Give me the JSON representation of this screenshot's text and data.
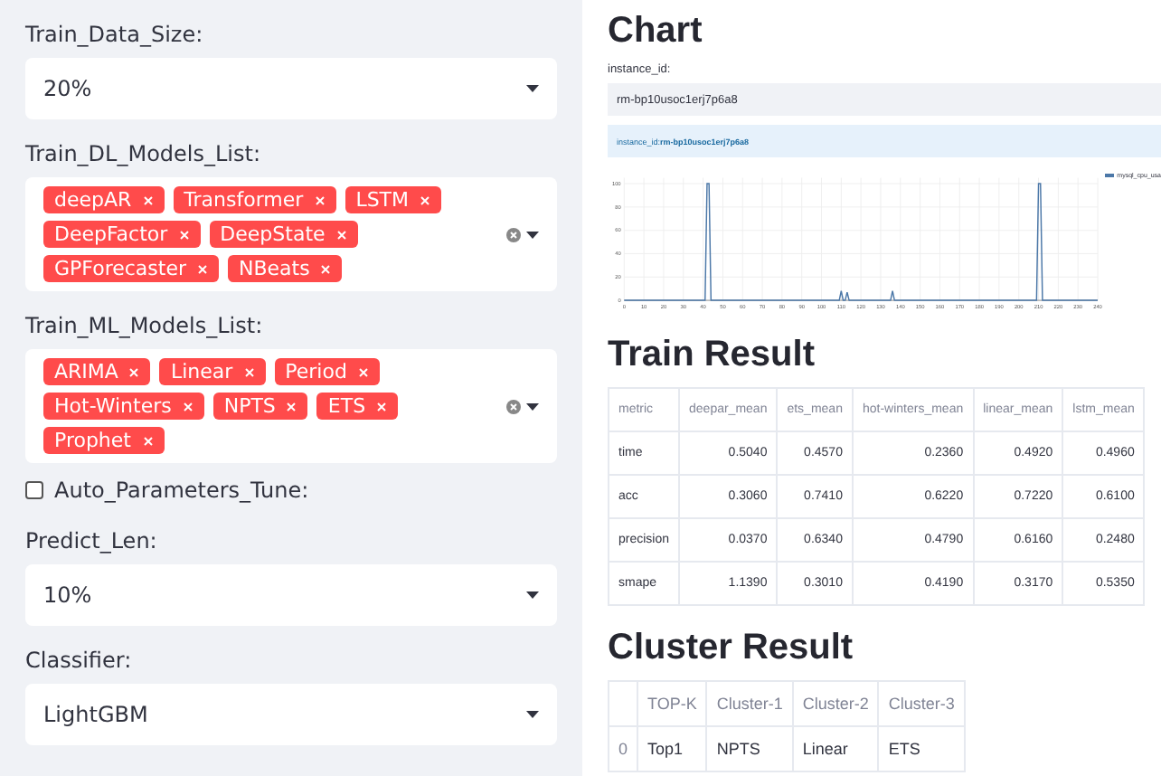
{
  "sidebar": {
    "controls": [
      {
        "kind": "select",
        "label": "Train_Data_Size:",
        "value": "20%"
      },
      {
        "kind": "multiselect",
        "label": "Train_DL_Models_List:",
        "tags": [
          "deepAR",
          "Transformer",
          "LSTM",
          "DeepFactor",
          "DeepState",
          "GPForecaster",
          "NBeats"
        ]
      },
      {
        "kind": "multiselect",
        "label": "Train_ML_Models_List:",
        "tags": [
          "ARIMA",
          "Linear",
          "Period",
          "Hot-Winters",
          "NPTS",
          "ETS",
          "Prophet"
        ]
      },
      {
        "kind": "checkbox",
        "label": "Auto_Parameters_Tune:",
        "checked": false
      },
      {
        "kind": "select",
        "label": "Predict_Len:",
        "value": "10%"
      },
      {
        "kind": "select",
        "label": "Classifier:",
        "value": "LightGBM"
      }
    ]
  },
  "chart_section": {
    "title": "Chart",
    "input_label": "instance_id:",
    "input_value": "rm-bp10usoc1erj7p6a8",
    "info_label": "instance_id:",
    "info_value": "rm-bp10usoc1erj7p6a8",
    "chart_data": {
      "type": "line",
      "grid": true,
      "x": [
        0,
        41,
        42,
        43,
        44,
        109,
        110,
        111,
        112,
        113,
        114,
        135,
        136,
        137,
        209,
        210,
        211,
        212,
        240
      ],
      "series": [
        {
          "name": "mysql_cpu_usa",
          "color": "#4c78a8",
          "values": [
            0,
            0,
            100,
            100,
            0,
            0,
            8,
            0,
            0,
            7,
            0,
            0,
            8,
            0,
            0,
            100,
            100,
            0,
            0
          ]
        }
      ],
      "xlim": [
        0,
        240
      ],
      "ylim": [
        0,
        105
      ],
      "xticks": [
        0,
        10,
        20,
        30,
        40,
        50,
        60,
        70,
        80,
        90,
        100,
        110,
        120,
        130,
        140,
        150,
        160,
        170,
        180,
        190,
        200,
        210,
        220,
        230,
        240
      ],
      "yticks": [
        0,
        20,
        40,
        60,
        80,
        100
      ]
    }
  },
  "train_result": {
    "title": "Train Result",
    "columns": [
      "metric",
      "deepar_mean",
      "ets_mean",
      "hot-winters_mean",
      "linear_mean",
      "lstm_mean"
    ],
    "rows": [
      [
        "time",
        "0.5040",
        "0.4570",
        "0.2360",
        "0.4920",
        "0.4960"
      ],
      [
        "acc",
        "0.3060",
        "0.7410",
        "0.6220",
        "0.7220",
        "0.6100"
      ],
      [
        "precision",
        "0.0370",
        "0.6340",
        "0.4790",
        "0.6160",
        "0.2480"
      ],
      [
        "smape",
        "1.1390",
        "0.3010",
        "0.4190",
        "0.3170",
        "0.5350"
      ]
    ]
  },
  "cluster_result": {
    "title": "Cluster Result",
    "columns": [
      "TOP-K",
      "Cluster-1",
      "Cluster-2",
      "Cluster-3"
    ],
    "rows": [
      {
        "index": "0",
        "cells": [
          "Top1",
          "NPTS",
          "Linear",
          "ETS"
        ]
      }
    ]
  }
}
